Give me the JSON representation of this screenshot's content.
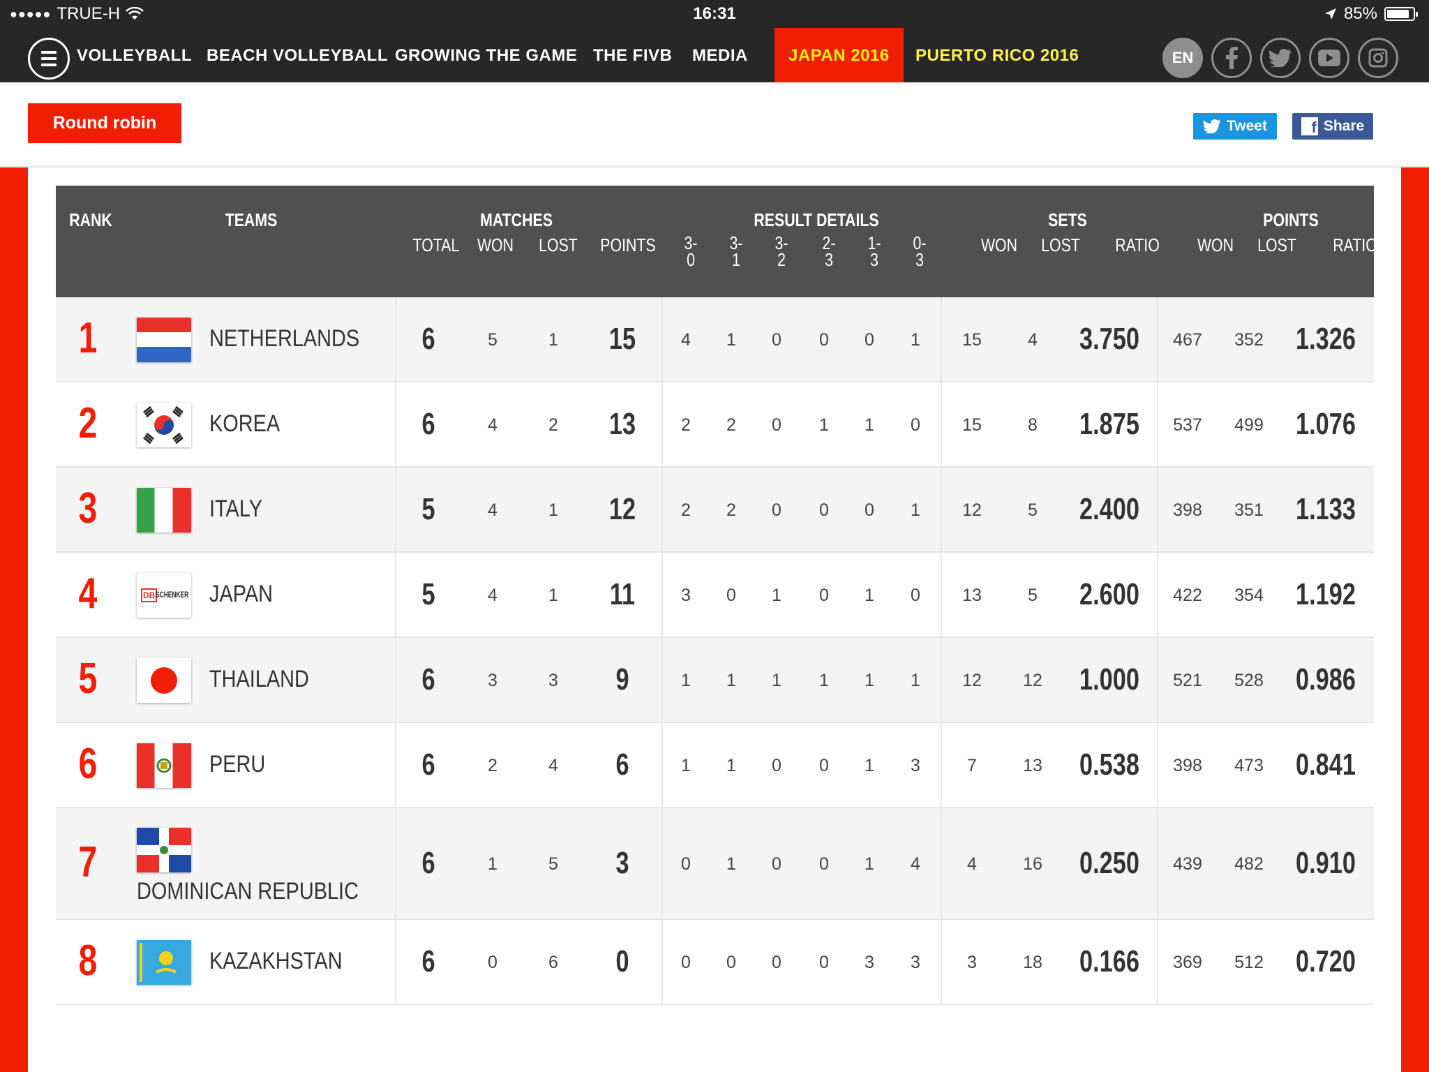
{
  "status": {
    "carrier": "TRUE-H",
    "time": "16:31",
    "battery": "85%",
    "battery_level": 0.85
  },
  "nav": {
    "items": [
      "VOLLEYBALL",
      "BEACH VOLLEYBALL",
      "GROWING THE GAME",
      "THE FIVB",
      "MEDIA",
      "JAPAN 2016",
      "PUERTO RICO 2016"
    ],
    "lang": "EN",
    "social_icons": [
      "facebook-icon",
      "twitter-icon",
      "youtube-icon",
      "instagram-icon"
    ]
  },
  "toolbar": {
    "round_robin": "Round robin",
    "tweet": "Tweet",
    "share": "Share"
  },
  "colors": {
    "accent": "#f21d05",
    "nav_bg": "#272727",
    "header_bg": "#505050",
    "tweet": "#1b95e0",
    "facebook": "#3b5998"
  },
  "table": {
    "headers": {
      "rank": "RANK",
      "teams": "TEAMS",
      "matches": "MATCHES",
      "result_details": "RESULT DETAILS",
      "sets": "SETS",
      "points": "POINTS",
      "total": "TOTAL",
      "won": "WON",
      "lost": "LOST",
      "points_col": "POINTS",
      "ratio": "RATIO",
      "r30": [
        "3-",
        "0"
      ],
      "r31": [
        "3-",
        "1"
      ],
      "r32": [
        "3-",
        "2"
      ],
      "r23": [
        "2-",
        "3"
      ],
      "r13": [
        "1-",
        "3"
      ],
      "r03": [
        "0-",
        "3"
      ]
    },
    "rows": [
      {
        "rank": "1",
        "team": "NETHERLANDS",
        "flag": "netherlands-flag",
        "total": "6",
        "won": "5",
        "lost": "1",
        "points": "15",
        "r30": "4",
        "r31": "1",
        "r32": "0",
        "r23": "0",
        "r13": "0",
        "r03": "1",
        "sets_won": "15",
        "sets_lost": "4",
        "sets_ratio": "3.750",
        "pts_won": "467",
        "pts_lost": "352",
        "pts_ratio": "1.326"
      },
      {
        "rank": "2",
        "team": "KOREA",
        "flag": "korea-flag",
        "total": "6",
        "won": "4",
        "lost": "2",
        "points": "13",
        "r30": "2",
        "r31": "2",
        "r32": "0",
        "r23": "1",
        "r13": "1",
        "r03": "0",
        "sets_won": "15",
        "sets_lost": "8",
        "sets_ratio": "1.875",
        "pts_won": "537",
        "pts_lost": "499",
        "pts_ratio": "1.076"
      },
      {
        "rank": "3",
        "team": "ITALY",
        "flag": "italy-flag",
        "total": "5",
        "won": "4",
        "lost": "1",
        "points": "12",
        "r30": "2",
        "r31": "2",
        "r32": "0",
        "r23": "0",
        "r13": "0",
        "r03": "1",
        "sets_won": "12",
        "sets_lost": "5",
        "sets_ratio": "2.400",
        "pts_won": "398",
        "pts_lost": "351",
        "pts_ratio": "1.133"
      },
      {
        "rank": "4",
        "team": "JAPAN",
        "flag": "db-schenker-logo",
        "logo_text": "SCHENKER",
        "logo_mark": "DB",
        "total": "5",
        "won": "4",
        "lost": "1",
        "points": "11",
        "r30": "3",
        "r31": "0",
        "r32": "1",
        "r23": "0",
        "r13": "1",
        "r03": "0",
        "sets_won": "13",
        "sets_lost": "5",
        "sets_ratio": "2.600",
        "pts_won": "422",
        "pts_lost": "354",
        "pts_ratio": "1.192"
      },
      {
        "rank": "5",
        "team": "THAILAND",
        "flag": "japan-flag",
        "total": "6",
        "won": "3",
        "lost": "3",
        "points": "9",
        "r30": "1",
        "r31": "1",
        "r32": "1",
        "r23": "1",
        "r13": "1",
        "r03": "1",
        "sets_won": "12",
        "sets_lost": "12",
        "sets_ratio": "1.000",
        "pts_won": "521",
        "pts_lost": "528",
        "pts_ratio": "0.986"
      },
      {
        "rank": "6",
        "team": "PERU",
        "flag": "peru-flag",
        "total": "6",
        "won": "2",
        "lost": "4",
        "points": "6",
        "r30": "1",
        "r31": "1",
        "r32": "0",
        "r23": "0",
        "r13": "1",
        "r03": "3",
        "sets_won": "7",
        "sets_lost": "13",
        "sets_ratio": "0.538",
        "pts_won": "398",
        "pts_lost": "473",
        "pts_ratio": "0.841"
      },
      {
        "rank": "7",
        "team": "DOMINICAN REPUBLIC",
        "flag": "dominican-republic-flag",
        "total": "6",
        "won": "1",
        "lost": "5",
        "points": "3",
        "r30": "0",
        "r31": "1",
        "r32": "0",
        "r23": "0",
        "r13": "1",
        "r03": "4",
        "sets_won": "4",
        "sets_lost": "16",
        "sets_ratio": "0.250",
        "pts_won": "439",
        "pts_lost": "482",
        "pts_ratio": "0.910"
      },
      {
        "rank": "8",
        "team": "KAZAKHSTAN",
        "flag": "kazakhstan-flag",
        "total": "6",
        "won": "0",
        "lost": "6",
        "points": "0",
        "r30": "0",
        "r31": "0",
        "r32": "0",
        "r23": "0",
        "r13": "3",
        "r03": "3",
        "sets_won": "3",
        "sets_lost": "18",
        "sets_ratio": "0.166",
        "pts_won": "369",
        "pts_lost": "512",
        "pts_ratio": "0.720"
      }
    ]
  }
}
